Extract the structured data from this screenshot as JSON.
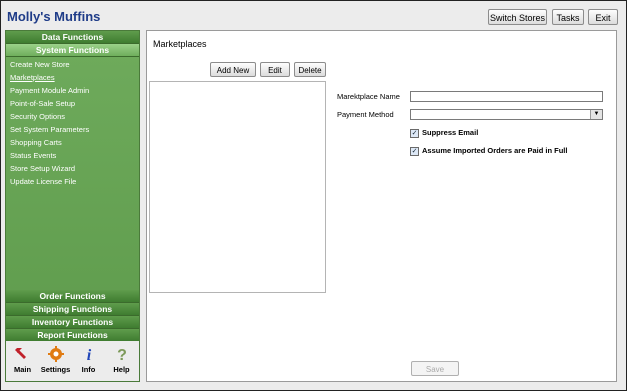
{
  "app_title": "Molly's Muffins",
  "top_buttons": {
    "switch_stores": "Switch Stores",
    "tasks": "Tasks",
    "exit": "Exit"
  },
  "sidebar": {
    "data_functions": "Data Functions",
    "system_functions": "System Functions",
    "items": [
      "Create New Store",
      "Marketplaces",
      "Payment Module Admin",
      "Point-of-Sale Setup",
      "Security Options",
      "Set System Parameters",
      "Shopping Carts",
      "Status Events",
      "Store Setup Wizard",
      "Update License File"
    ],
    "order_functions": "Order Functions",
    "shipping_functions": "Shipping Functions",
    "inventory_functions": "Inventory Functions",
    "report_functions": "Report Functions",
    "bottom": {
      "main": "Main",
      "settings": "Settings",
      "info": "Info",
      "help": "Help"
    }
  },
  "content": {
    "title": "Marketplaces",
    "add_new": "Add New",
    "edit": "Edit",
    "delete": "Delete",
    "marketplace_name_label": "Marektplace Name",
    "payment_method_label": "Payment Method",
    "suppress_email_label": "Suppress Email",
    "assume_paid_label": "Assume Imported Orders are Paid in Full",
    "save": "Save",
    "suppress_email_checked": true,
    "assume_paid_checked": true
  },
  "colors": {
    "sidebar_green": "#5d9a4b",
    "title_blue": "#1f3c88"
  }
}
